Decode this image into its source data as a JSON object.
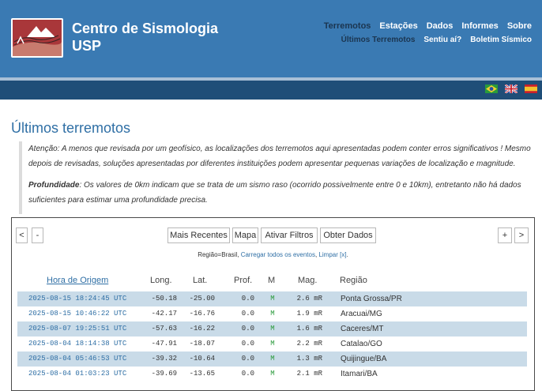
{
  "header": {
    "title_line1": "Centro de Sismologia",
    "title_line2": "USP",
    "nav_row1": [
      "Terremotos",
      "Estações",
      "Dados",
      "Informes",
      "Sobre"
    ],
    "nav_row2": [
      "Últimos Terremotos",
      "Sentiu aí?",
      "Boletim Sísmico"
    ],
    "active_nav": "Terremotos",
    "flags": [
      "brazil-flag-icon",
      "uk-flag-icon",
      "spain-flag-icon"
    ]
  },
  "page": {
    "title": "Últimos terremotos",
    "notice1": "Atenção: A menos que revisada por um geofísico, as localizações dos terremotos aqui apresentadas podem conter erros significativos ! Mesmo depois de revisadas, soluções apresentadas por diferentes instituições podem apresentar pequenas variações de localização e magnitude.",
    "notice2_label": "Profundidade",
    "notice2_text": ": Os valores de 0km indicam que se trata de um sismo raso (ocorrido possivelmente entre 0 e 10km), entretanto não há dados suficientes para estimar uma profundidade precisa."
  },
  "toolbar": {
    "prev_label": "<",
    "minus_label": "-",
    "recent_label": "Mais Recentes",
    "map_label": "Mapa",
    "filters_label": "Ativar Filtros",
    "data_label": "Obter Dados",
    "plus_label": "+",
    "next_label": ">"
  },
  "filter": {
    "prefix": "Região=Brasil,",
    "load_all": "Carregar todos os eventos",
    "sep": ",",
    "clear": "Limpar [x]",
    "suffix": "."
  },
  "table": {
    "headers": {
      "time": "Hora de Origem",
      "lon": "Long.",
      "lat": "Lat.",
      "depth": "Prof.",
      "m": "M",
      "mag": "Mag.",
      "region": "Região"
    },
    "rows": [
      {
        "time": "2025-08-15 18:24:45 UTC",
        "lon": "-50.18",
        "lat": "-25.00",
        "depth": "0.0",
        "m": "M",
        "mag": "2.6 mR",
        "region": "Ponta Grossa/PR"
      },
      {
        "time": "2025-08-15 10:46:22 UTC",
        "lon": "-42.17",
        "lat": "-16.76",
        "depth": "0.0",
        "m": "M",
        "mag": "1.9 mR",
        "region": "Aracuai/MG"
      },
      {
        "time": "2025-08-07 19:25:51 UTC",
        "lon": "-57.63",
        "lat": "-16.22",
        "depth": "0.0",
        "m": "M",
        "mag": "1.6 mR",
        "region": "Caceres/MT"
      },
      {
        "time": "2025-08-04 18:14:38 UTC",
        "lon": "-47.91",
        "lat": "-18.07",
        "depth": "0.0",
        "m": "M",
        "mag": "2.2 mR",
        "region": "Catalao/GO"
      },
      {
        "time": "2025-08-04 05:46:53 UTC",
        "lon": "-39.32",
        "lat": "-10.64",
        "depth": "0.0",
        "m": "M",
        "mag": "1.3 mR",
        "region": "Quijingue/BA"
      },
      {
        "time": "2025-08-04 01:03:23 UTC",
        "lon": "-39.69",
        "lat": "-13.65",
        "depth": "0.0",
        "m": "M",
        "mag": "2.1 mR",
        "region": "Itamari/BA"
      }
    ]
  },
  "colors": {
    "header_bg": "#3a7ab3",
    "dark_bar": "#1f4e78",
    "link": "#2f6fa5",
    "row_shade": "#c9dbe8",
    "m_green": "#2e9c3f"
  }
}
